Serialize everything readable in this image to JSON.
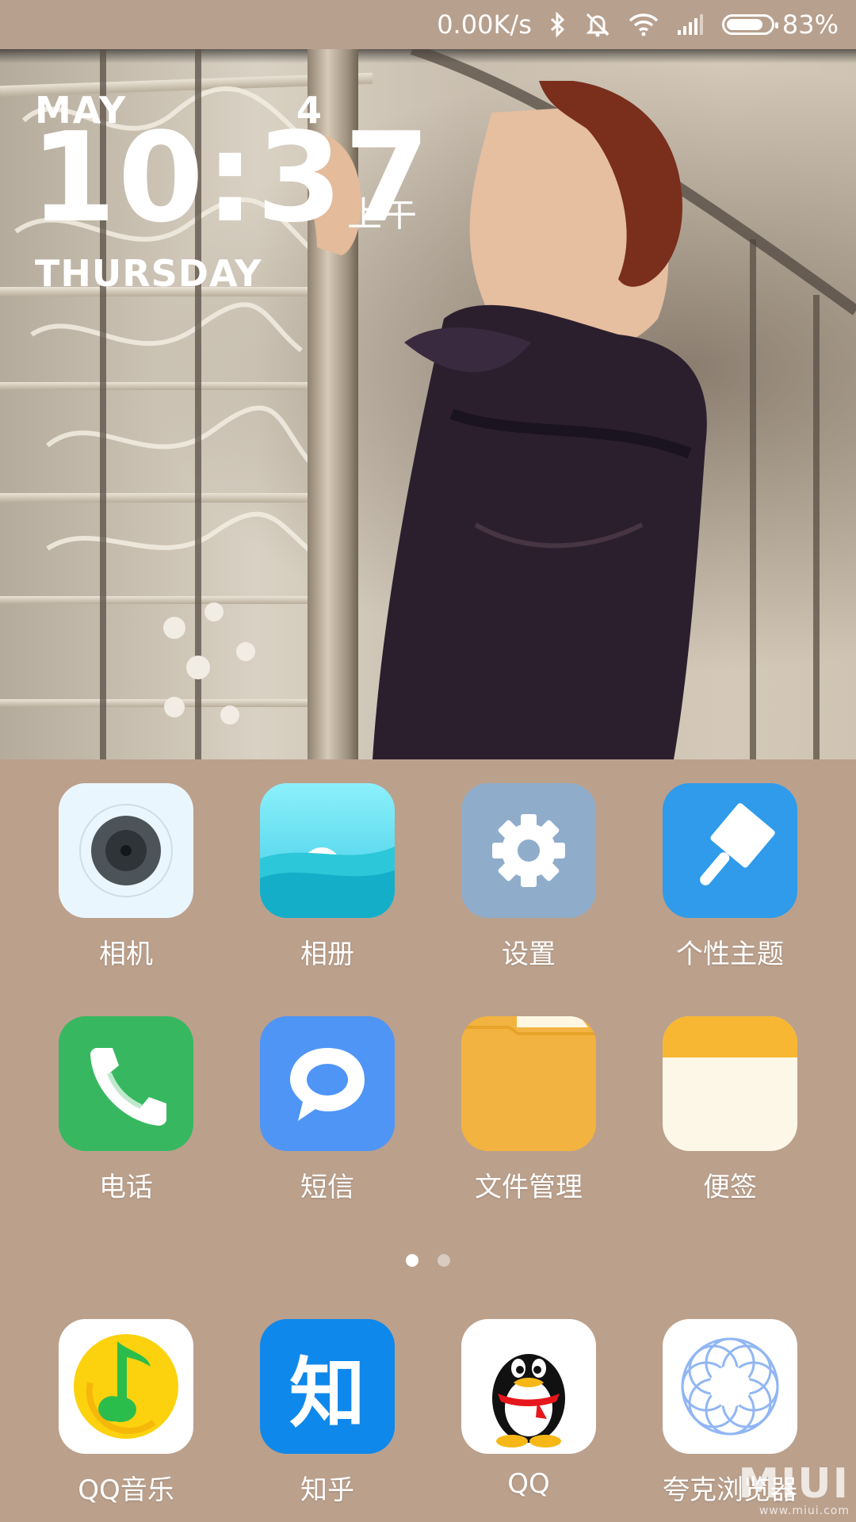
{
  "status_bar": {
    "net_speed": "0.00K/s",
    "icons": [
      "bluetooth-icon",
      "silent-icon",
      "wifi-icon",
      "signal-icon"
    ],
    "battery_level": 0.83,
    "battery_percent": "83%"
  },
  "lockscreen_clock": {
    "month": "MAY",
    "day": "4",
    "time": "10:37",
    "ampm": "上午",
    "weekday": "THURSDAY"
  },
  "apps_page": [
    {
      "label": "相机",
      "icon": "camera-icon",
      "color": "#eaf6fd"
    },
    {
      "label": "相册",
      "icon": "gallery-icon",
      "color": "#38c6dc"
    },
    {
      "label": "设置",
      "icon": "settings-gear-icon",
      "color": "#8aa8c6"
    },
    {
      "label": "个性主题",
      "icon": "theme-brush-icon",
      "color": "#2f9bea"
    },
    {
      "label": "电话",
      "icon": "phone-icon",
      "color": "#37b860"
    },
    {
      "label": "短信",
      "icon": "message-icon",
      "color": "#4f95f5"
    },
    {
      "label": "文件管理",
      "icon": "folder-icon",
      "color": "#f2b340"
    },
    {
      "label": "便签",
      "icon": "notes-icon",
      "color": "#f8b732"
    }
  ],
  "page_indicator": {
    "total": 2,
    "active": 0
  },
  "dock": [
    {
      "label": "QQ音乐",
      "icon": "qq-music-icon",
      "color": "#ffffff"
    },
    {
      "label": "知乎",
      "icon": "zhihu-icon",
      "color": "#0f88eb",
      "glyph": "知"
    },
    {
      "label": "QQ",
      "icon": "qq-penguin-icon",
      "color": "#ffffff"
    },
    {
      "label": "夸克浏览器",
      "icon": "quark-browser-icon",
      "color": "#ffffff"
    }
  ],
  "watermark": {
    "brand": "MIUI",
    "url": "www.miui.com"
  }
}
